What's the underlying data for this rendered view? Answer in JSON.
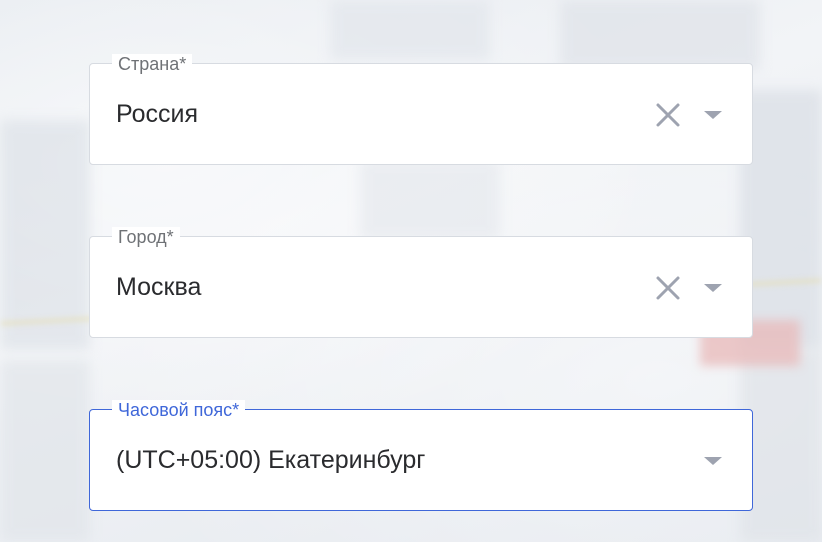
{
  "form": {
    "country": {
      "label": "Страна*",
      "value": "Россия",
      "clear_icon": "close-icon",
      "dropdown_icon": "caret-down-icon"
    },
    "city": {
      "label": "Город*",
      "value": "Москва",
      "clear_icon": "close-icon",
      "dropdown_icon": "caret-down-icon"
    },
    "timezone": {
      "label": "Часовой пояс*",
      "value": "(UTC+05:00) Екатеринбург",
      "dropdown_icon": "caret-down-icon",
      "focused": true
    }
  },
  "colors": {
    "focus_accent": "#3f67d9",
    "icon_gray": "#9ea3b0",
    "text": "#2a2b2e",
    "label_gray": "#6f7276"
  }
}
